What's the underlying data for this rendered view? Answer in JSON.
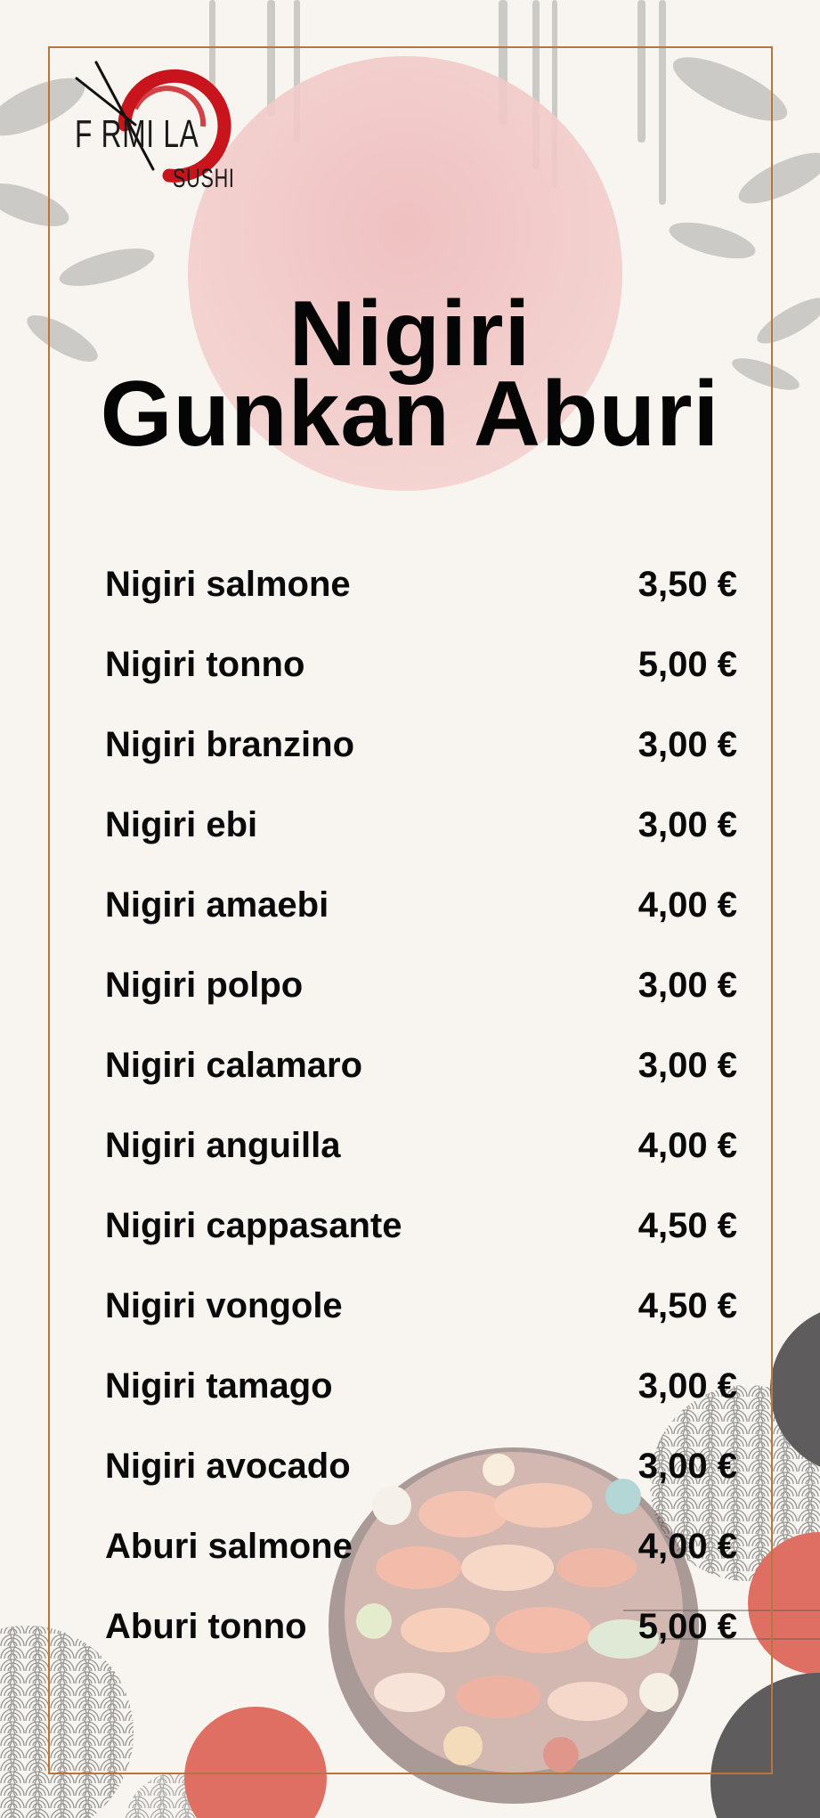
{
  "logo": {
    "main_text": "F RMI LA",
    "sub_text": "SUSHI"
  },
  "title": {
    "line1": "Nigiri",
    "line2": "Gunkan Aburi"
  },
  "menu": [
    {
      "name": "Nigiri salmone",
      "price": "3,50 €"
    },
    {
      "name": "Nigiri tonno",
      "price": "5,00 €"
    },
    {
      "name": "Nigiri branzino",
      "price": "3,00 €"
    },
    {
      "name": "Nigiri ebi",
      "price": "3,00 €"
    },
    {
      "name": "Nigiri amaebi",
      "price": "4,00 €"
    },
    {
      "name": "Nigiri polpo",
      "price": "3,00 €"
    },
    {
      "name": "Nigiri calamaro",
      "price": "3,00 €"
    },
    {
      "name": "Nigiri anguilla",
      "price": "4,00 €"
    },
    {
      "name": "Nigiri cappasante",
      "price": "4,50 €"
    },
    {
      "name": "Nigiri vongole",
      "price": "4,50 €"
    },
    {
      "name": "Nigiri tamago",
      "price": "3,00 €"
    },
    {
      "name": "Nigiri avocado",
      "price": "3,00 €"
    },
    {
      "name": "Aburi salmone",
      "price": "4,00 €"
    },
    {
      "name": "Aburi tonno",
      "price": "5,00 €"
    }
  ],
  "colors": {
    "background": "#f8f5f0",
    "frame": "#b5773f",
    "sun": "#eab6b6",
    "accent_red": "#df6f62",
    "dark_gray": "#5f5c5d",
    "logo_red": "#c8141c"
  },
  "icons": [
    "chopsticks-icon",
    "sushi-platter-illustration",
    "seigaiha-wave-pattern",
    "bamboo-leaves-decoration"
  ]
}
